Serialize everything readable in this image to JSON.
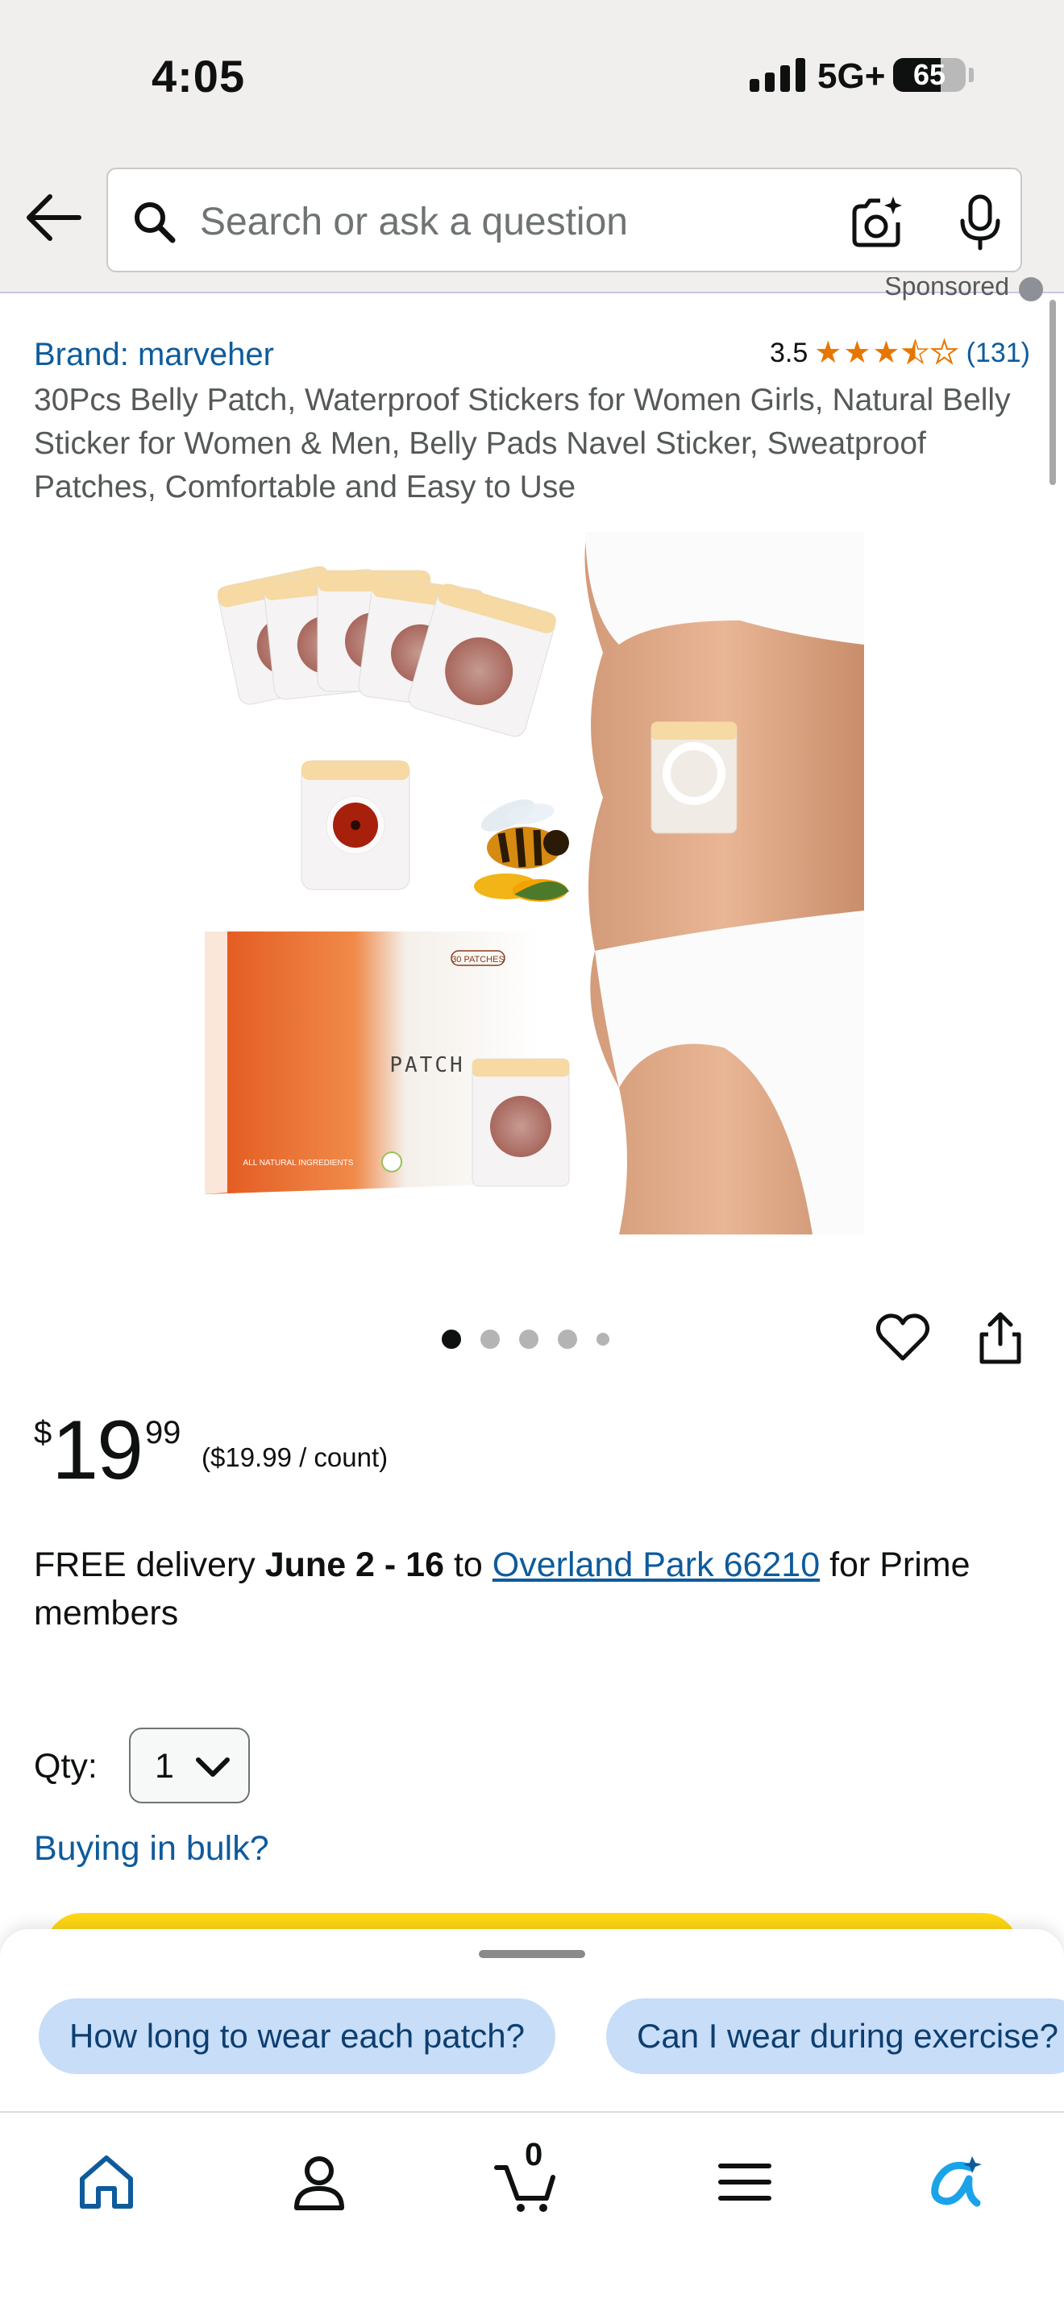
{
  "status_bar": {
    "time": "4:05",
    "network": "5G+",
    "battery": "65",
    "battery_level": 0.65
  },
  "search": {
    "placeholder": "Search or ask a question"
  },
  "product": {
    "sponsored_label": "Sponsored",
    "brand": "Brand: marveher",
    "rating_value": "3.5",
    "rating_stars": 3.5,
    "rating_count": "(131)",
    "title": "30Pcs Belly Patch, Waterproof Stickers for Women Girls, Natural Belly Sticker for Women & Men, Belly Pads Navel Sticker, Sweatproof Patches, Comfortable and Easy to Use",
    "image_text": {
      "box_label": "PATCH",
      "box_count": "30 PATCHES",
      "box_footer": "ALL NATURAL INGREDIENTS"
    },
    "carousel": {
      "total_images": 5,
      "active_index": 0
    }
  },
  "price": {
    "symbol": "$",
    "whole": "19",
    "fraction": "99",
    "unit_price": "($19.99 / count)"
  },
  "delivery": {
    "prefix": "FREE delivery ",
    "dates": "June 2 - 16",
    "to": " to ",
    "location": "Overland Park 66210",
    "suffix": " for Prime members"
  },
  "quantity": {
    "label": "Qty:",
    "value": "1"
  },
  "bulk_link": "Buying in bulk?",
  "suggestions": [
    "How long to wear each patch?",
    "Can I wear during exercise?"
  ],
  "tabbar": {
    "cart_count": "0",
    "items": [
      "home-icon",
      "account-icon",
      "cart-icon",
      "menu-icon",
      "rufus-icon"
    ]
  },
  "colors": {
    "link": "#0e5b9c",
    "star": "#e77600",
    "buy_button": "#ffd814",
    "chip": "#c7ddf8",
    "header_bg": "#f0efed"
  }
}
